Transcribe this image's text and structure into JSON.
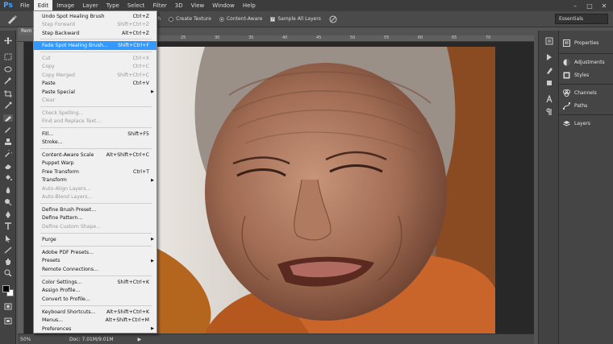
{
  "app": {
    "logo": "Ps"
  },
  "menubar": {
    "items": [
      "File",
      "Edit",
      "Image",
      "Layer",
      "Type",
      "Select",
      "Filter",
      "3D",
      "View",
      "Window",
      "Help"
    ],
    "active": "Edit"
  },
  "options": {
    "match_label": "atch",
    "create_texture_label": "Create Texture",
    "content_aware_label": "Content-Aware",
    "sample_all_label": "Sample All Layers",
    "workspace": "Essentials"
  },
  "document": {
    "tab_label": "Rem",
    "ruler_ticks": [
      "5",
      "10",
      "15",
      "20",
      "25",
      "30",
      "35",
      "40",
      "45",
      "50",
      "55",
      "60",
      "65",
      "70"
    ],
    "zoom": "50%",
    "doc_info": "Doc: 7.01M/9.01M"
  },
  "panels": {
    "items": [
      "Properties",
      "Adjustments",
      "Styles",
      "Channels",
      "Paths",
      "Layers"
    ]
  },
  "edit_menu": {
    "items": [
      {
        "label": "Undo Spot Healing Brush",
        "shortcut": "Ctrl+Z",
        "disabled": false
      },
      {
        "label": "Step Forward",
        "shortcut": "Shift+Ctrl+Z",
        "disabled": true
      },
      {
        "label": "Step Backward",
        "shortcut": "Alt+Ctrl+Z",
        "disabled": false
      },
      {
        "label": "Fade Spot Healing Brush...",
        "shortcut": "Shift+Ctrl+F",
        "disabled": false,
        "highlighted": true
      },
      {
        "label": "Cut",
        "shortcut": "Ctrl+X",
        "disabled": true
      },
      {
        "label": "Copy",
        "shortcut": "Ctrl+C",
        "disabled": true
      },
      {
        "label": "Copy Merged",
        "shortcut": "Shift+Ctrl+C",
        "disabled": true
      },
      {
        "label": "Paste",
        "shortcut": "Ctrl+V",
        "disabled": false
      },
      {
        "label": "Paste Special",
        "shortcut": "",
        "disabled": false,
        "submenu": true
      },
      {
        "label": "Clear",
        "shortcut": "",
        "disabled": true
      },
      {
        "label": "Check Spelling...",
        "shortcut": "",
        "disabled": true
      },
      {
        "label": "Find and Replace Text...",
        "shortcut": "",
        "disabled": true
      },
      {
        "label": "Fill...",
        "shortcut": "Shift+F5",
        "disabled": false
      },
      {
        "label": "Stroke...",
        "shortcut": "",
        "disabled": false
      },
      {
        "label": "Content-Aware Scale",
        "shortcut": "Alt+Shift+Ctrl+C",
        "disabled": false
      },
      {
        "label": "Puppet Warp",
        "shortcut": "",
        "disabled": false
      },
      {
        "label": "Free Transform",
        "shortcut": "Ctrl+T",
        "disabled": false
      },
      {
        "label": "Transform",
        "shortcut": "",
        "disabled": false,
        "submenu": true
      },
      {
        "label": "Auto-Align Layers...",
        "shortcut": "",
        "disabled": true
      },
      {
        "label": "Auto-Blend Layers...",
        "shortcut": "",
        "disabled": true
      },
      {
        "label": "Define Brush Preset...",
        "shortcut": "",
        "disabled": false
      },
      {
        "label": "Define Pattern...",
        "shortcut": "",
        "disabled": false
      },
      {
        "label": "Define Custom Shape...",
        "shortcut": "",
        "disabled": true
      },
      {
        "label": "Purge",
        "shortcut": "",
        "disabled": false,
        "submenu": true
      },
      {
        "label": "Adobe PDF Presets...",
        "shortcut": "",
        "disabled": false
      },
      {
        "label": "Presets",
        "shortcut": "",
        "disabled": false,
        "submenu": true
      },
      {
        "label": "Remote Connections...",
        "shortcut": "",
        "disabled": false
      },
      {
        "label": "Color Settings...",
        "shortcut": "Shift+Ctrl+K",
        "disabled": false
      },
      {
        "label": "Assign Profile...",
        "shortcut": "",
        "disabled": false
      },
      {
        "label": "Convert to Profile...",
        "shortcut": "",
        "disabled": false
      },
      {
        "label": "Keyboard Shortcuts...",
        "shortcut": "Alt+Shift+Ctrl+K",
        "disabled": false
      },
      {
        "label": "Menus...",
        "shortcut": "Alt+Shift+Ctrl+M",
        "disabled": false
      },
      {
        "label": "Preferences",
        "shortcut": "",
        "disabled": false,
        "submenu": true
      }
    ]
  },
  "colors": {
    "menu_highlight": "#3399ff",
    "ui_dark": "#535353",
    "foreground_swatch": "#000000",
    "background_swatch": "#ffffff"
  }
}
